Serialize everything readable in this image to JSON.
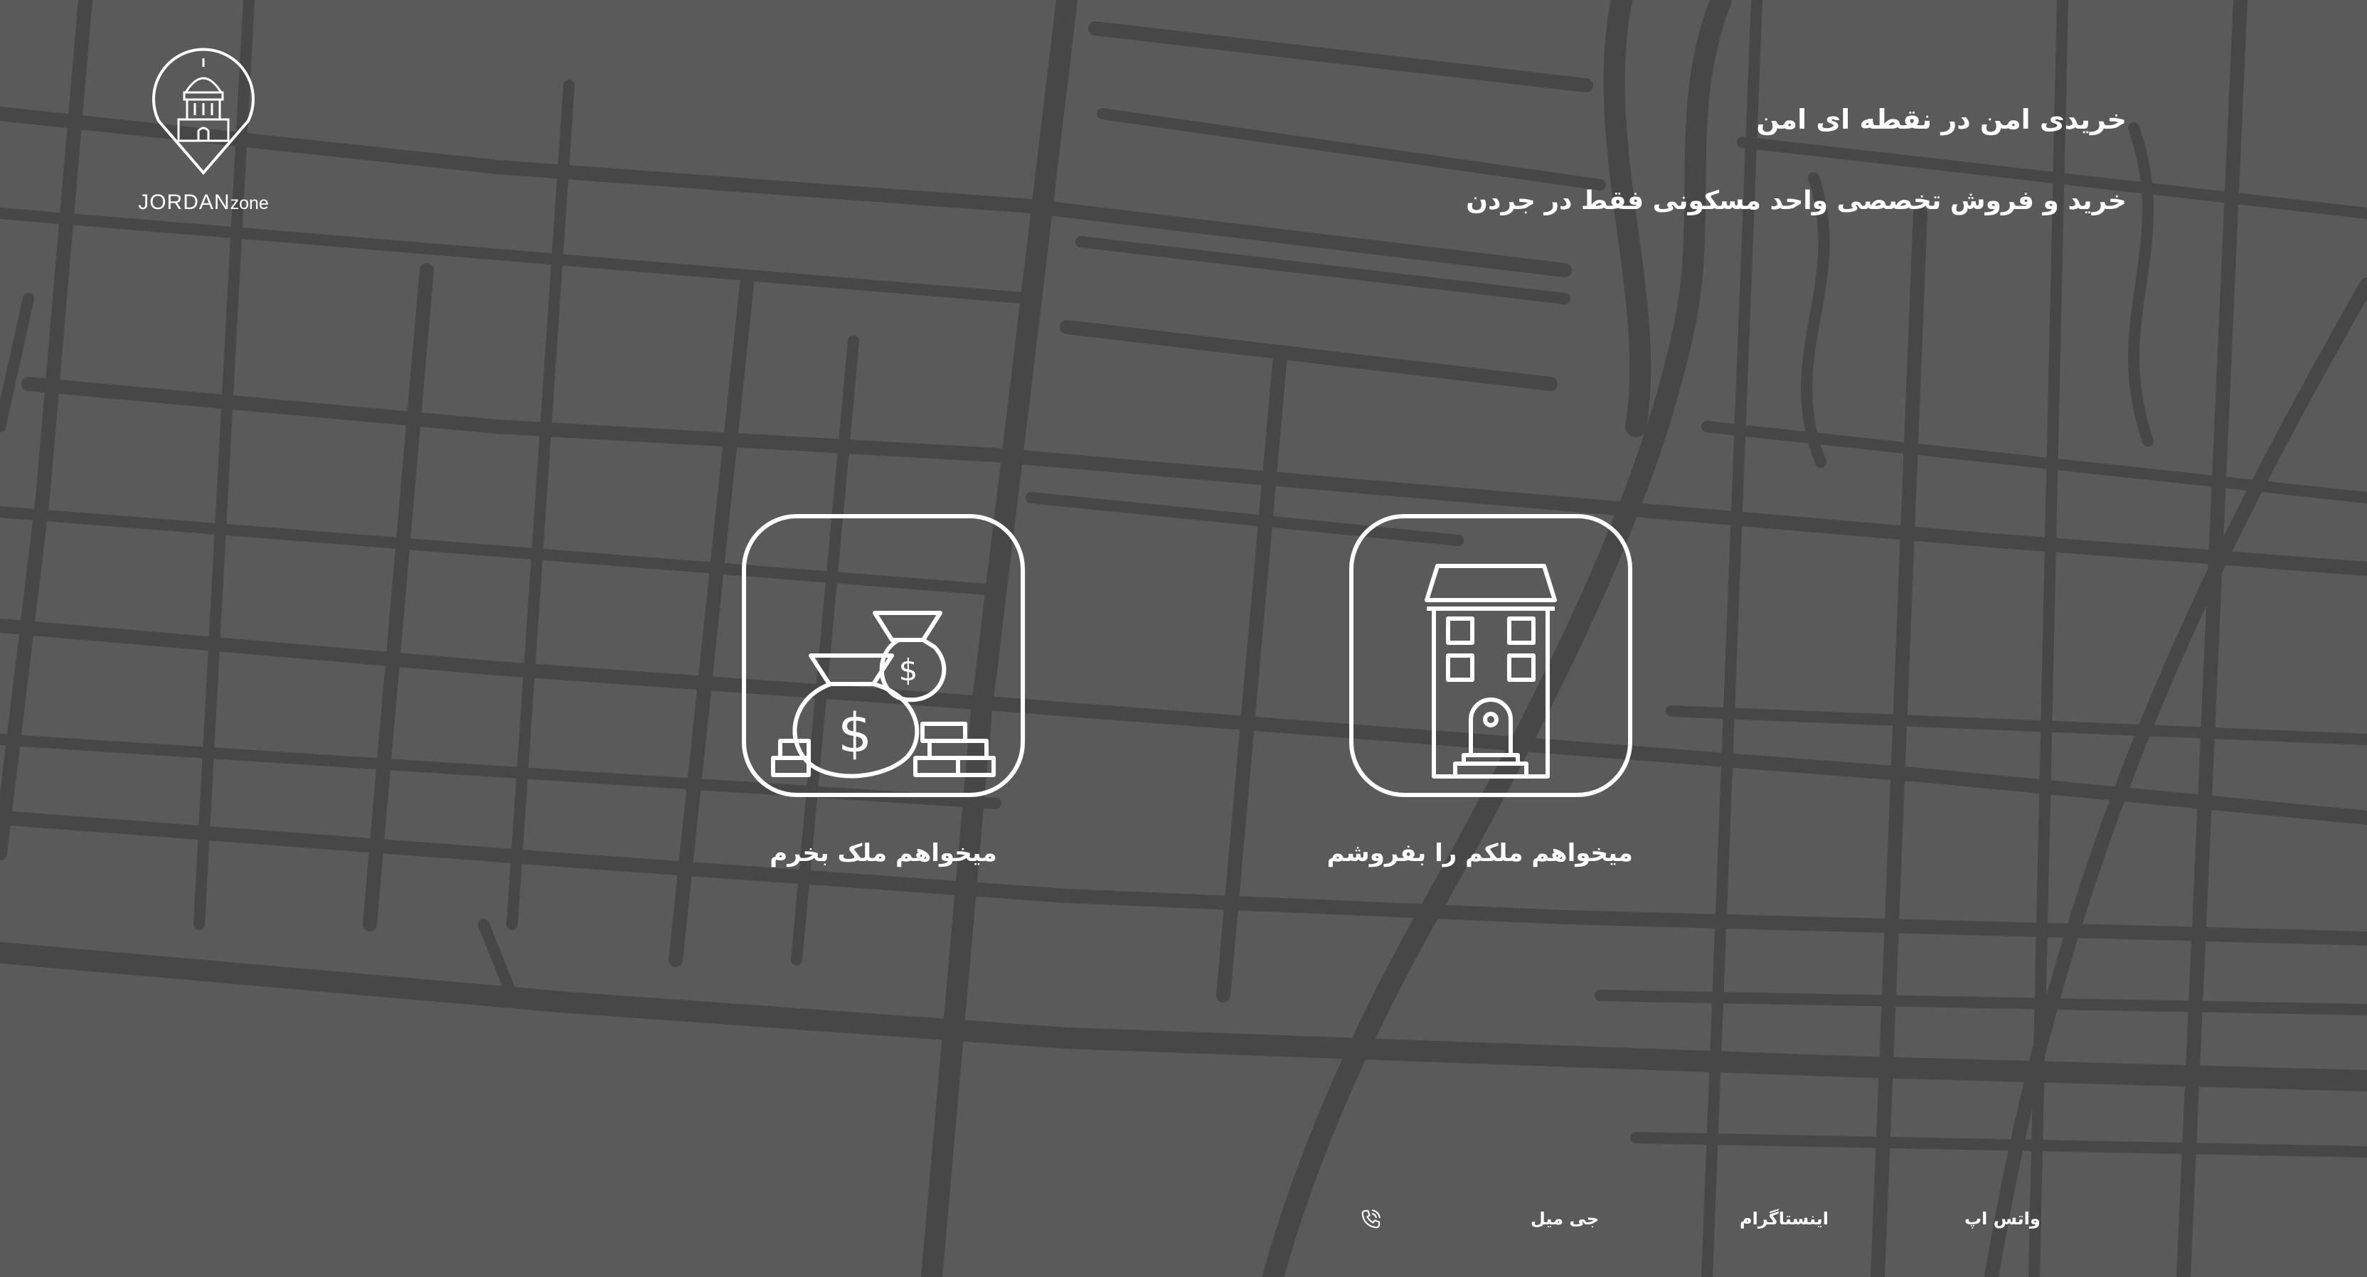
{
  "brand": {
    "name_main": "JORDAN",
    "name_suffix": "zone"
  },
  "hero": {
    "title": "خریدی امن در نقطه ای امن",
    "subtitle": "خرید و فروش تخصصی واحد مسکونی فقط در جردن"
  },
  "actions": {
    "buy_label": "میخواهم ملک بخرم",
    "sell_label": "میخواهم ملکم را بفروشم"
  },
  "footer": {
    "whatsapp": "واتس اپ",
    "instagram": "اینستاگرام",
    "gmail": "جی میل",
    "phone_icon": "phone-icon"
  },
  "colors": {
    "background": "#5a5a5a",
    "roads": "#474747",
    "foreground": "#ffffff"
  }
}
